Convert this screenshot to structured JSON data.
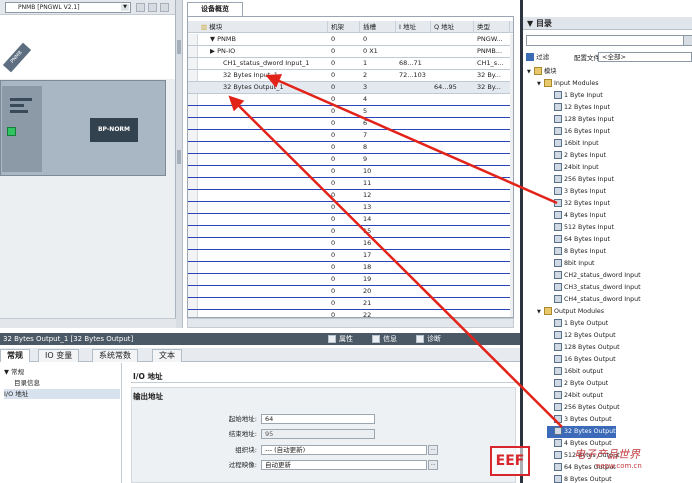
{
  "left_view": {
    "device_select": "PNMB [PNGWL V2.1]",
    "module_tag": "PNMB",
    "bp_label": "BP-NORM"
  },
  "overview": {
    "tab_title": "设备概览",
    "columns": [
      "模块",
      "机架",
      "插槽",
      "I 地址",
      "Q 地址",
      "类型"
    ],
    "rows": [
      {
        "module": "▼ PNMB",
        "rack": "0",
        "slot": "0",
        "i_addr": "",
        "q_addr": "",
        "type": "PNGW..."
      },
      {
        "module": "▶ PN-IO",
        "rack": "0",
        "slot": "0 X1",
        "i_addr": "",
        "q_addr": "",
        "type": "PNMB..."
      },
      {
        "module": "CH1_status_dword Input_1",
        "rack": "0",
        "slot": "1",
        "i_addr": "68...71",
        "q_addr": "",
        "type": "CH1_s..."
      },
      {
        "module": "32 Bytes Input_1",
        "rack": "0",
        "slot": "2",
        "i_addr": "72...103",
        "q_addr": "",
        "type": "32 By..."
      },
      {
        "module": "32 Bytes Output_1",
        "rack": "0",
        "slot": "3",
        "i_addr": "",
        "q_addr": "64...95",
        "type": "32 By..."
      },
      {
        "module": "",
        "rack": "0",
        "slot": "4",
        "i_addr": "",
        "q_addr": "",
        "type": ""
      },
      {
        "module": "",
        "rack": "0",
        "slot": "5",
        "i_addr": "",
        "q_addr": "",
        "type": ""
      },
      {
        "module": "",
        "rack": "0",
        "slot": "6",
        "i_addr": "",
        "q_addr": "",
        "type": ""
      },
      {
        "module": "",
        "rack": "0",
        "slot": "7",
        "i_addr": "",
        "q_addr": "",
        "type": ""
      },
      {
        "module": "",
        "rack": "0",
        "slot": "8",
        "i_addr": "",
        "q_addr": "",
        "type": ""
      },
      {
        "module": "",
        "rack": "0",
        "slot": "9",
        "i_addr": "",
        "q_addr": "",
        "type": ""
      },
      {
        "module": "",
        "rack": "0",
        "slot": "10",
        "i_addr": "",
        "q_addr": "",
        "type": ""
      },
      {
        "module": "",
        "rack": "0",
        "slot": "11",
        "i_addr": "",
        "q_addr": "",
        "type": ""
      },
      {
        "module": "",
        "rack": "0",
        "slot": "12",
        "i_addr": "",
        "q_addr": "",
        "type": ""
      },
      {
        "module": "",
        "rack": "0",
        "slot": "13",
        "i_addr": "",
        "q_addr": "",
        "type": ""
      },
      {
        "module": "",
        "rack": "0",
        "slot": "14",
        "i_addr": "",
        "q_addr": "",
        "type": ""
      },
      {
        "module": "",
        "rack": "0",
        "slot": "15",
        "i_addr": "",
        "q_addr": "",
        "type": ""
      },
      {
        "module": "",
        "rack": "0",
        "slot": "16",
        "i_addr": "",
        "q_addr": "",
        "type": ""
      },
      {
        "module": "",
        "rack": "0",
        "slot": "17",
        "i_addr": "",
        "q_addr": "",
        "type": ""
      },
      {
        "module": "",
        "rack": "0",
        "slot": "18",
        "i_addr": "",
        "q_addr": "",
        "type": ""
      },
      {
        "module": "",
        "rack": "0",
        "slot": "19",
        "i_addr": "",
        "q_addr": "",
        "type": ""
      },
      {
        "module": "",
        "rack": "0",
        "slot": "20",
        "i_addr": "",
        "q_addr": "",
        "type": ""
      },
      {
        "module": "",
        "rack": "0",
        "slot": "21",
        "i_addr": "",
        "q_addr": "",
        "type": ""
      },
      {
        "module": "",
        "rack": "0",
        "slot": "22",
        "i_addr": "",
        "q_addr": "",
        "type": ""
      }
    ]
  },
  "catalog": {
    "title": "目录",
    "filter_label": "过滤",
    "profile_label": "配置文件",
    "profile_value": "<全部>",
    "tree": [
      {
        "label": "模块",
        "level": 0,
        "kind": "folder",
        "exp": "▼"
      },
      {
        "label": "Input Modules",
        "level": 1,
        "kind": "folder",
        "exp": "▼"
      },
      {
        "label": "1 Byte Input",
        "level": 2,
        "kind": "mod",
        "exp": ""
      },
      {
        "label": "12 Bytes Input",
        "level": 2,
        "kind": "mod",
        "exp": ""
      },
      {
        "label": "128 Bytes Input",
        "level": 2,
        "kind": "mod",
        "exp": ""
      },
      {
        "label": "16 Bytes Input",
        "level": 2,
        "kind": "mod",
        "exp": ""
      },
      {
        "label": "16bit Input",
        "level": 2,
        "kind": "mod",
        "exp": ""
      },
      {
        "label": "2 Bytes Input",
        "level": 2,
        "kind": "mod",
        "exp": ""
      },
      {
        "label": "24bit Input",
        "level": 2,
        "kind": "mod",
        "exp": ""
      },
      {
        "label": "256 Bytes Input",
        "level": 2,
        "kind": "mod",
        "exp": ""
      },
      {
        "label": "3 Bytes Input",
        "level": 2,
        "kind": "mod",
        "exp": ""
      },
      {
        "label": "32 Bytes Input",
        "level": 2,
        "kind": "mod",
        "exp": ""
      },
      {
        "label": "4 Bytes Input",
        "level": 2,
        "kind": "mod",
        "exp": ""
      },
      {
        "label": "512 Bytes Input",
        "level": 2,
        "kind": "mod",
        "exp": ""
      },
      {
        "label": "64 Bytes Input",
        "level": 2,
        "kind": "mod",
        "exp": ""
      },
      {
        "label": "8 Bytes Input",
        "level": 2,
        "kind": "mod",
        "exp": ""
      },
      {
        "label": "8bit Input",
        "level": 2,
        "kind": "mod",
        "exp": ""
      },
      {
        "label": "CH2_status_dword Input",
        "level": 2,
        "kind": "mod",
        "exp": ""
      },
      {
        "label": "CH3_status_dword Input",
        "level": 2,
        "kind": "mod",
        "exp": ""
      },
      {
        "label": "CH4_status_dword Input",
        "level": 2,
        "kind": "mod",
        "exp": ""
      },
      {
        "label": "Output Modules",
        "level": 1,
        "kind": "folder",
        "exp": "▼"
      },
      {
        "label": "1 Byte Output",
        "level": 2,
        "kind": "mod",
        "exp": ""
      },
      {
        "label": "12 Bytes Output",
        "level": 2,
        "kind": "mod",
        "exp": ""
      },
      {
        "label": "128 Bytes Output",
        "level": 2,
        "kind": "mod",
        "exp": ""
      },
      {
        "label": "16 Bytes Output",
        "level": 2,
        "kind": "mod",
        "exp": ""
      },
      {
        "label": "16bit output",
        "level": 2,
        "kind": "mod",
        "exp": ""
      },
      {
        "label": "2 Byte Output",
        "level": 2,
        "kind": "mod",
        "exp": ""
      },
      {
        "label": "24bit output",
        "level": 2,
        "kind": "mod",
        "exp": ""
      },
      {
        "label": "256 Bytes Output",
        "level": 2,
        "kind": "mod",
        "exp": ""
      },
      {
        "label": "3 Bytes Output",
        "level": 2,
        "kind": "mod",
        "exp": ""
      },
      {
        "label": "32 Bytes Output",
        "level": 2,
        "kind": "mod",
        "exp": "",
        "selected": true
      },
      {
        "label": "4 Bytes Output",
        "level": 2,
        "kind": "mod",
        "exp": ""
      },
      {
        "label": "512 Bytes Output",
        "level": 2,
        "kind": "mod",
        "exp": ""
      },
      {
        "label": "64 Bytes Output",
        "level": 2,
        "kind": "mod",
        "exp": ""
      },
      {
        "label": "8 Bytes Output",
        "level": 2,
        "kind": "mod",
        "exp": ""
      }
    ]
  },
  "inspector": {
    "title": "32 Bytes Output_1 [32 Bytes Output]",
    "prop_tab": "属性",
    "info_tab": "信息",
    "diag_tab": "诊断",
    "tabs": [
      "常规",
      "IO 变量",
      "系统常数",
      "文本"
    ],
    "nav": [
      {
        "label": "▼ 常规",
        "indent": 0
      },
      {
        "label": "目录信息",
        "indent": 1
      },
      {
        "label": "I/O 地址",
        "indent": 0,
        "selected": true
      }
    ],
    "io_heading": "I/O 地址",
    "out_heading": "输出地址",
    "fields": {
      "start_label": "起始地址:",
      "start_value": "64",
      "end_label": "结束地址:",
      "end_value": "95",
      "ob_label": "组织块:",
      "ob_value": "--- (自动更新)",
      "pi_label": "过程映像:",
      "pi_value": "自动更新"
    }
  },
  "watermark": {
    "logo": "EEF",
    "text_cn": "电子产品世界",
    "url": "eepw.com.cn"
  }
}
